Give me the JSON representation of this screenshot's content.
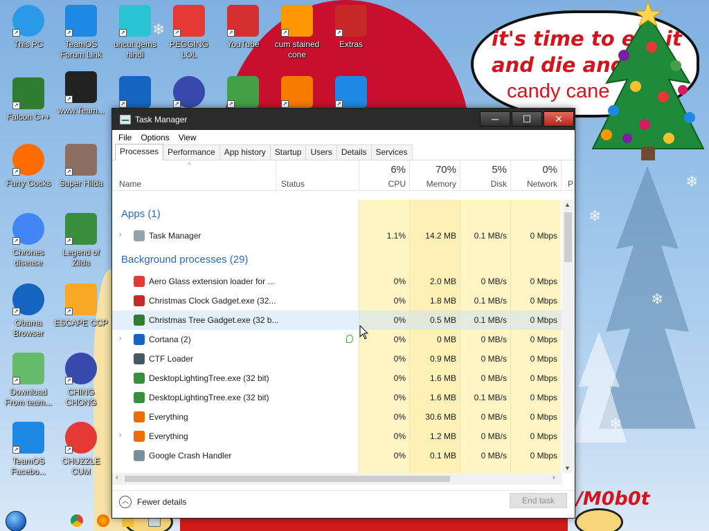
{
  "desktop": {
    "bubble_text": [
      "it's time to eat it",
      "and die and",
      "candy cane"
    ],
    "signature": "/M0b0t",
    "icons": [
      {
        "label": "This PC",
        "icon": "computer-icon",
        "color": "#2b9ae6"
      },
      {
        "label": "TeamOS Forum Link",
        "icon": "gear-icon",
        "color": "#1e88e5"
      },
      {
        "label": "uncut gems hindi",
        "icon": "gem-icon",
        "color": "#29c5d6"
      },
      {
        "label": "PEGGING LOL",
        "icon": "p-logo-icon",
        "color": "#e53935"
      },
      {
        "label": "YouTube",
        "icon": "angry-bird-icon",
        "color": "#d32f2f"
      },
      {
        "label": "cum stained cone",
        "icon": "cone-icon",
        "color": "#ff9800"
      },
      {
        "label": "Extras",
        "icon": "extras-icon",
        "color": "#c62828"
      },
      {
        "label": "Falcon C++",
        "icon": "recycle-icon",
        "color": "#2e7d32"
      },
      {
        "label": "www.Team...",
        "icon": "book-icon",
        "color": "#222222"
      },
      {
        "label": "",
        "icon": "number-two-icon",
        "color": "#1565c0"
      },
      {
        "label": "",
        "icon": "orb-icon",
        "color": "#3949ab"
      },
      {
        "label": "",
        "icon": "csharp-icon",
        "color": "#43a047"
      },
      {
        "label": "",
        "icon": "hxd-icon",
        "color": "#f57c00"
      },
      {
        "label": "",
        "icon": "wg-icon",
        "color": "#1e88e5"
      },
      {
        "label": "Furry Cocks",
        "icon": "firefox-icon",
        "color": "#ff6d00"
      },
      {
        "label": "Super Hilda",
        "icon": "pixel-icon",
        "color": "#8d6e63"
      },
      {
        "label": "Chrones disease",
        "icon": "chrome-icon",
        "color": "#4285f4"
      },
      {
        "label": "Legend of Zilda",
        "icon": "zelda-icon",
        "color": "#388e3c"
      },
      {
        "label": "Obama Browser",
        "icon": "obama-icon",
        "color": "#1565c0"
      },
      {
        "label": "ESCAPE CCP",
        "icon": "escape-icon",
        "color": "#f9a825"
      },
      {
        "label": "Download From team...",
        "icon": "notepad-icon",
        "color": "#66bb6a"
      },
      {
        "label": "CHING CHONG",
        "icon": "orb-icon",
        "color": "#3949ab"
      },
      {
        "label": "TeamOS Facebo...",
        "icon": "gear-icon",
        "color": "#1e88e5"
      },
      {
        "label": "CHUZZLE CUM",
        "icon": "chuzzle-icon",
        "color": "#e53935"
      }
    ]
  },
  "taskmanager": {
    "title": "Task Manager",
    "menu": [
      "File",
      "Options",
      "View"
    ],
    "tabs": [
      "Processes",
      "Performance",
      "App history",
      "Startup",
      "Users",
      "Details",
      "Services"
    ],
    "active_tab": "Processes",
    "header": {
      "name": "Name",
      "status": "Status",
      "cpu_pct": "6%",
      "cpu": "CPU",
      "mem_pct": "70%",
      "mem": "Memory",
      "disk_pct": "5%",
      "disk": "Disk",
      "net_pct": "0%",
      "net": "Network",
      "more": "P"
    },
    "groups": {
      "apps": "Apps (1)",
      "background": "Background processes (29)"
    },
    "apps": [
      {
        "name": "Task Manager",
        "cpu": "1.1%",
        "memory": "14.2 MB",
        "disk": "0.1 MB/s",
        "network": "0 Mbps",
        "expandable": true,
        "icon": "task-manager-icon",
        "color": "#90a4ae"
      }
    ],
    "background": [
      {
        "name": "Aero Glass extension loader for ...",
        "cpu": "0%",
        "memory": "2.0 MB",
        "disk": "0 MB/s",
        "network": "0 Mbps",
        "expandable": false,
        "icon": "ornament-icon",
        "color": "#e53935"
      },
      {
        "name": "Christmas Clock Gadget.exe (32...",
        "cpu": "0%",
        "memory": "1.8 MB",
        "disk": "0.1 MB/s",
        "network": "0 Mbps",
        "expandable": false,
        "icon": "clock-icon",
        "color": "#c62828"
      },
      {
        "name": "Christmas Tree Gadget.exe (32 b...",
        "cpu": "0%",
        "memory": "0.5 MB",
        "disk": "0.1 MB/s",
        "network": "0 Mbps",
        "expandable": false,
        "icon": "tree-icon",
        "color": "#2e7d32"
      },
      {
        "name": "Cortana (2)",
        "cpu": "0%",
        "memory": "0 MB",
        "disk": "0 MB/s",
        "network": "0 Mbps",
        "expandable": true,
        "icon": "cortana-icon",
        "color": "#1565c0"
      },
      {
        "name": "CTF Loader",
        "cpu": "0%",
        "memory": "0.9 MB",
        "disk": "0 MB/s",
        "network": "0 Mbps",
        "expandable": false,
        "icon": "ctf-icon",
        "color": "#455a64"
      },
      {
        "name": "DesktopLightingTree.exe (32 bit)",
        "cpu": "0%",
        "memory": "1.6 MB",
        "disk": "0 MB/s",
        "network": "0 Mbps",
        "expandable": false,
        "icon": "tree-icon",
        "color": "#388e3c"
      },
      {
        "name": "DesktopLightingTree.exe (32 bit)",
        "cpu": "0%",
        "memory": "1.6 MB",
        "disk": "0.1 MB/s",
        "network": "0 Mbps",
        "expandable": false,
        "icon": "tree-icon",
        "color": "#388e3c"
      },
      {
        "name": "Everything",
        "cpu": "0%",
        "memory": "30.6 MB",
        "disk": "0 MB/s",
        "network": "0 Mbps",
        "expandable": false,
        "icon": "magnifier-icon",
        "color": "#ef6c00"
      },
      {
        "name": "Everything",
        "cpu": "0%",
        "memory": "1.2 MB",
        "disk": "0 MB/s",
        "network": "0 Mbps",
        "expandable": true,
        "icon": "magnifier-icon",
        "color": "#ef6c00"
      },
      {
        "name": "Google Crash Handler",
        "cpu": "0%",
        "memory": "0.1 MB",
        "disk": "0 MB/s",
        "network": "0 Mbps",
        "expandable": false,
        "icon": "crash-handler-icon",
        "color": "#78909c"
      }
    ],
    "fewer_details": "Fewer details",
    "end_task": "End task"
  }
}
